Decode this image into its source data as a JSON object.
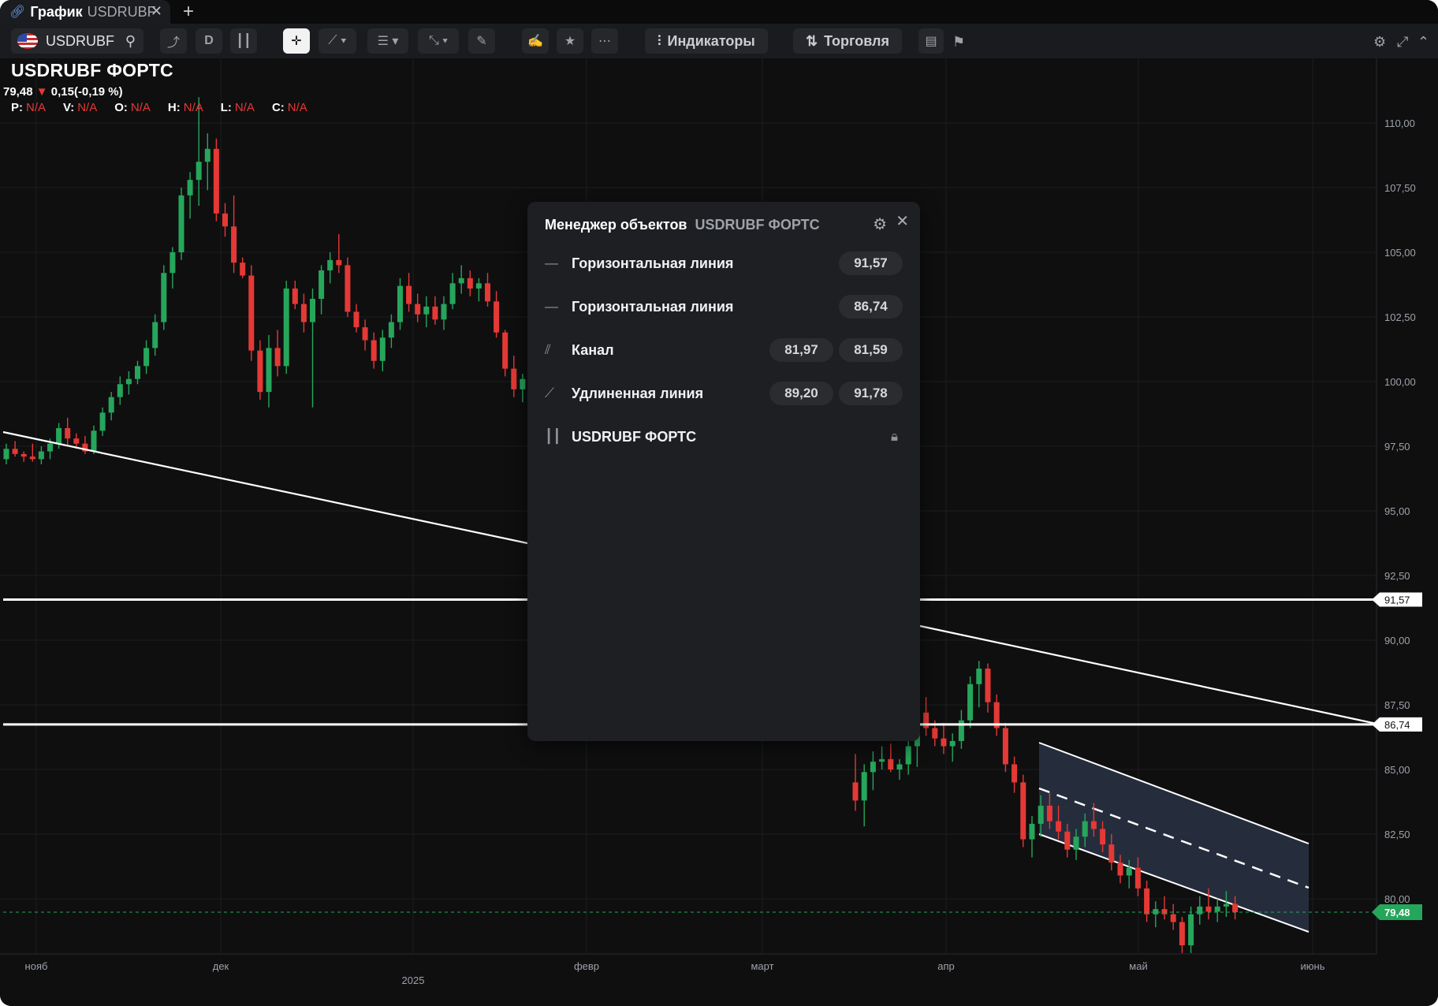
{
  "tab": {
    "title_strong": "График",
    "title_light": "USDRUBF"
  },
  "toolbar": {
    "symbol": "USDRUBF",
    "interval": "D",
    "indicators_label": "Индикаторы",
    "trading_label": "Торговля"
  },
  "legend": {
    "symbol_title": "USDRUBF ФОРТС",
    "last_price": "79,48",
    "change": "0,15(-0,19 %)",
    "ohlc": [
      {
        "key": "P:",
        "value": "N/A"
      },
      {
        "key": "V:",
        "value": "N/A"
      },
      {
        "key": "O:",
        "value": "N/A"
      },
      {
        "key": "H:",
        "value": "N/A"
      },
      {
        "key": "L:",
        "value": "N/A"
      },
      {
        "key": "C:",
        "value": "N/A"
      }
    ]
  },
  "object_manager": {
    "title": "Менеджер объектов",
    "subtitle": "USDRUBF ФОРТС",
    "items": [
      {
        "icon": "horizontal-line-icon",
        "label": "Горизонтальная линия",
        "values": [
          "91,57"
        ]
      },
      {
        "icon": "horizontal-line-icon",
        "label": "Горизонтальная линия",
        "values": [
          "86,74"
        ]
      },
      {
        "icon": "channel-icon",
        "label": "Канал",
        "values": [
          "81,97",
          "81,59"
        ]
      },
      {
        "icon": "extended-line-icon",
        "label": "Удлиненная линия",
        "values": [
          "89,20",
          "91,78"
        ]
      },
      {
        "icon": "candles-icon",
        "label": "USDRUBF ФОРТС",
        "values": [],
        "locked": true
      }
    ]
  },
  "colors": {
    "up": "#26a65b",
    "down": "#e53935",
    "background": "#0f0f10",
    "grid": "#1d1e21",
    "line": "#ffffff",
    "last_price_badge": "#26a65b",
    "channel_fill": "#2a3448"
  },
  "chart_data": {
    "type": "candlestick",
    "ylim": [
      77.5,
      111.5
    ],
    "y_ticks": [
      "110,00",
      "107,50",
      "105,00",
      "102,50",
      "100,00",
      "97,50",
      "95,00",
      "92,50",
      "90,00",
      "87,50",
      "85,00",
      "82,50",
      "80,00"
    ],
    "y_tick_values": [
      110,
      107.5,
      105,
      102.5,
      100,
      97.5,
      95,
      92.5,
      90,
      87.5,
      85,
      82.5,
      80
    ],
    "x_ticks": [
      "нояб",
      "дек",
      "2025",
      "февр",
      "март",
      "апр",
      "май",
      "июнь"
    ],
    "horizontal_lines": [
      {
        "value": 91.57,
        "label": "91,57"
      },
      {
        "value": 86.74,
        "label": "86,74"
      }
    ],
    "last_price": {
      "value": 79.48,
      "label": "79,48"
    },
    "channel": {
      "start_value": 81.97,
      "end_value": 81.59,
      "note": "descending channel"
    },
    "extended_line": {
      "p1": 89.2,
      "p2": 91.78
    },
    "candles": [
      [
        97.0,
        97.6,
        96.8,
        97.4
      ],
      [
        97.4,
        97.7,
        97.1,
        97.2
      ],
      [
        97.2,
        97.3,
        96.9,
        97.1
      ],
      [
        97.1,
        97.6,
        96.9,
        97.0
      ],
      [
        97.0,
        97.5,
        96.8,
        97.3
      ],
      [
        97.3,
        97.8,
        97.0,
        97.6
      ],
      [
        97.6,
        98.4,
        97.4,
        98.2
      ],
      [
        98.2,
        98.6,
        97.5,
        97.8
      ],
      [
        97.8,
        98.0,
        97.4,
        97.6
      ],
      [
        97.6,
        97.9,
        97.2,
        97.3
      ],
      [
        97.3,
        98.3,
        97.2,
        98.1
      ],
      [
        98.1,
        99.0,
        97.9,
        98.8
      ],
      [
        98.8,
        99.6,
        98.5,
        99.4
      ],
      [
        99.4,
        100.2,
        99.1,
        99.9
      ],
      [
        99.9,
        100.4,
        99.5,
        100.1
      ],
      [
        100.1,
        100.8,
        99.9,
        100.6
      ],
      [
        100.6,
        101.6,
        100.3,
        101.3
      ],
      [
        101.3,
        102.6,
        101.0,
        102.3
      ],
      [
        102.3,
        104.5,
        102.0,
        104.2
      ],
      [
        104.2,
        105.2,
        103.6,
        105.0
      ],
      [
        105.0,
        107.5,
        104.7,
        107.2
      ],
      [
        107.2,
        108.1,
        106.3,
        107.8
      ],
      [
        107.8,
        111.0,
        106.8,
        108.5
      ],
      [
        108.5,
        109.6,
        107.4,
        109.0
      ],
      [
        109.0,
        109.4,
        106.2,
        106.5
      ],
      [
        106.5,
        106.9,
        105.6,
        106.0
      ],
      [
        106.0,
        107.2,
        104.2,
        104.6
      ],
      [
        104.6,
        104.8,
        104.0,
        104.1
      ],
      [
        104.1,
        104.5,
        100.8,
        101.2
      ],
      [
        101.2,
        101.6,
        99.3,
        99.6
      ],
      [
        99.6,
        101.8,
        99.0,
        101.3
      ],
      [
        101.3,
        102.0,
        100.2,
        100.6
      ],
      [
        100.6,
        103.9,
        100.3,
        103.6
      ],
      [
        103.6,
        103.9,
        102.8,
        103.0
      ],
      [
        103.0,
        103.4,
        101.9,
        102.3
      ],
      [
        102.3,
        103.6,
        99.0,
        103.2
      ],
      [
        103.2,
        104.5,
        102.6,
        104.3
      ],
      [
        104.3,
        105.0,
        103.8,
        104.7
      ],
      [
        104.7,
        105.7,
        104.2,
        104.5
      ],
      [
        104.5,
        104.8,
        102.5,
        102.7
      ],
      [
        102.7,
        103.0,
        101.9,
        102.1
      ],
      [
        102.1,
        102.4,
        101.2,
        101.6
      ],
      [
        101.6,
        101.9,
        100.5,
        100.8
      ],
      [
        100.8,
        102.0,
        100.4,
        101.7
      ],
      [
        101.7,
        102.6,
        101.3,
        102.3
      ],
      [
        102.3,
        104.0,
        102.0,
        103.7
      ],
      [
        103.7,
        104.2,
        102.7,
        103.0
      ],
      [
        103.0,
        103.4,
        102.3,
        102.6
      ],
      [
        102.6,
        103.3,
        102.1,
        102.9
      ],
      [
        102.9,
        103.3,
        102.2,
        102.4
      ],
      [
        102.4,
        103.3,
        102.0,
        103.0
      ],
      [
        103.0,
        104.2,
        102.8,
        103.8
      ],
      [
        103.8,
        104.5,
        103.4,
        104.0
      ],
      [
        104.0,
        104.3,
        103.3,
        103.6
      ],
      [
        103.6,
        104.0,
        103.1,
        103.8
      ],
      [
        103.8,
        104.2,
        102.9,
        103.1
      ],
      [
        103.1,
        103.5,
        101.7,
        101.9
      ],
      [
        101.9,
        102.0,
        100.2,
        100.5
      ],
      [
        100.5,
        101.0,
        99.4,
        99.7
      ],
      [
        99.7,
        100.3,
        99.2,
        100.1
      ],
      [
        84.5,
        85.6,
        83.4,
        83.8
      ],
      [
        83.8,
        85.2,
        82.8,
        84.9
      ],
      [
        84.9,
        85.7,
        84.2,
        85.3
      ],
      [
        85.3,
        85.9,
        85.0,
        85.4
      ],
      [
        85.4,
        86.0,
        84.9,
        85.0
      ],
      [
        85.0,
        85.4,
        84.6,
        85.2
      ],
      [
        85.2,
        86.2,
        84.8,
        85.9
      ],
      [
        85.9,
        87.5,
        85.1,
        87.2
      ],
      [
        87.2,
        87.8,
        86.3,
        86.6
      ],
      [
        86.6,
        86.9,
        85.9,
        86.2
      ],
      [
        86.2,
        86.8,
        85.6,
        85.9
      ],
      [
        85.9,
        86.4,
        85.3,
        86.1
      ],
      [
        86.1,
        87.3,
        85.8,
        86.9
      ],
      [
        86.9,
        88.6,
        86.6,
        88.3
      ],
      [
        88.3,
        89.2,
        87.4,
        88.9
      ],
      [
        88.9,
        89.1,
        87.2,
        87.6
      ],
      [
        87.6,
        87.9,
        86.3,
        86.6
      ],
      [
        86.6,
        86.8,
        84.9,
        85.2
      ],
      [
        85.2,
        85.5,
        84.1,
        84.5
      ],
      [
        84.5,
        84.8,
        82.0,
        82.3
      ],
      [
        82.3,
        83.2,
        81.6,
        82.9
      ],
      [
        82.9,
        84.0,
        82.4,
        83.6
      ],
      [
        83.6,
        84.1,
        82.7,
        83.0
      ],
      [
        83.0,
        83.6,
        82.3,
        82.6
      ],
      [
        82.6,
        82.9,
        81.6,
        81.9
      ],
      [
        81.9,
        82.7,
        81.5,
        82.4
      ],
      [
        82.4,
        83.3,
        82.0,
        83.0
      ],
      [
        83.0,
        83.7,
        82.4,
        82.7
      ],
      [
        82.7,
        83.0,
        81.8,
        82.1
      ],
      [
        82.1,
        82.5,
        81.1,
        81.4
      ],
      [
        81.4,
        81.7,
        80.6,
        80.9
      ],
      [
        80.9,
        81.5,
        80.4,
        81.2
      ],
      [
        81.2,
        81.6,
        80.1,
        80.4
      ],
      [
        80.4,
        80.7,
        79.1,
        79.4
      ],
      [
        79.4,
        79.9,
        78.9,
        79.6
      ],
      [
        79.6,
        80.1,
        79.2,
        79.4
      ],
      [
        79.4,
        79.8,
        78.8,
        79.1
      ],
      [
        79.1,
        79.3,
        77.9,
        78.2
      ],
      [
        78.2,
        79.7,
        77.9,
        79.4
      ],
      [
        79.4,
        80.1,
        79.0,
        79.7
      ],
      [
        79.7,
        80.4,
        79.2,
        79.5
      ],
      [
        79.5,
        80.0,
        79.1,
        79.7
      ],
      [
        79.7,
        80.3,
        79.3,
        79.8
      ],
      [
        79.8,
        80.1,
        79.2,
        79.48
      ]
    ]
  }
}
